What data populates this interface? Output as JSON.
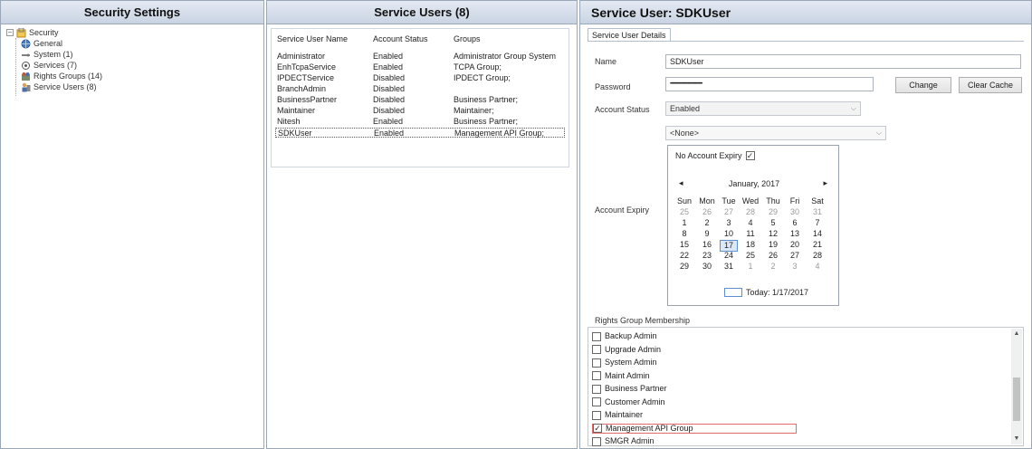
{
  "left_pane": {
    "title": "Security Settings",
    "tree": [
      {
        "label": "Security",
        "icon": "security-folder-icon"
      },
      {
        "label": "General",
        "icon": "globe-icon"
      },
      {
        "label": "System (1)",
        "icon": "system-icon"
      },
      {
        "label": "Services (7)",
        "icon": "services-icon"
      },
      {
        "label": "Rights Groups (14)",
        "icon": "rights-groups-icon"
      },
      {
        "label": "Service Users (8)",
        "icon": "service-users-icon"
      }
    ],
    "expander": "−"
  },
  "mid_pane": {
    "title": "Service Users (8)",
    "columns": [
      "Service User Name",
      "Account Status",
      "Groups"
    ],
    "rows": [
      {
        "name": "Administrator",
        "status": "Enabled",
        "groups": "Administrator Group System"
      },
      {
        "name": "EnhTcpaService",
        "status": "Enabled",
        "groups": "TCPA Group;"
      },
      {
        "name": "IPDECTService",
        "status": "Disabled",
        "groups": "IPDECT Group;"
      },
      {
        "name": "BranchAdmin",
        "status": "Disabled",
        "groups": ""
      },
      {
        "name": "BusinessPartner",
        "status": "Disabled",
        "groups": "Business Partner;"
      },
      {
        "name": "Maintainer",
        "status": "Disabled",
        "groups": "Maintainer;"
      },
      {
        "name": "Nitesh",
        "status": "Enabled",
        "groups": "Business Partner;"
      },
      {
        "name": "SDKUser",
        "status": "Enabled",
        "groups": "Management API Group;"
      }
    ]
  },
  "right_pane": {
    "title": "Service User:  SDKUser",
    "tab_label": "Service User Details",
    "name_label": "Name",
    "name_value": "SDKUser",
    "password_label": "Password",
    "password_value": "••••••••••••••••••••••••••••••••",
    "change_button": "Change",
    "clear_cache_button": "Clear Cache",
    "status_label": "Account Status",
    "status_value": "Enabled",
    "expiry_label": "Account Expiry",
    "expiry_value": "<None>",
    "no_expiry_label": "No Account Expiry",
    "no_expiry_check": "✓",
    "calendar": {
      "month_label": "January, 2017",
      "prev": "◂",
      "next": "▸",
      "day_names": [
        "Sun",
        "Mon",
        "Tue",
        "Wed",
        "Thu",
        "Fri",
        "Sat"
      ],
      "weeks": [
        [
          "25",
          "26",
          "27",
          "28",
          "29",
          "30",
          "31"
        ],
        [
          "1",
          "2",
          "3",
          "4",
          "5",
          "6",
          "7"
        ],
        [
          "8",
          "9",
          "10",
          "11",
          "12",
          "13",
          "14"
        ],
        [
          "15",
          "16",
          "17",
          "18",
          "19",
          "20",
          "21"
        ],
        [
          "22",
          "23",
          "24",
          "25",
          "26",
          "27",
          "28"
        ],
        [
          "29",
          "30",
          "31",
          "1",
          "2",
          "3",
          "4"
        ]
      ],
      "selected_day": "17",
      "today_label": "Today: 1/17/2017"
    },
    "rights_label": "Rights Group Membership",
    "rights_groups": [
      {
        "label": "Backup Admin",
        "checked": false
      },
      {
        "label": "Upgrade Admin",
        "checked": false
      },
      {
        "label": "System Admin",
        "checked": false
      },
      {
        "label": "Maint Admin",
        "checked": false
      },
      {
        "label": "Business Partner",
        "checked": false
      },
      {
        "label": "Customer Admin",
        "checked": false
      },
      {
        "label": "Maintainer",
        "checked": false
      },
      {
        "label": "Management API Group",
        "checked": true
      },
      {
        "label": "SMGR Admin",
        "checked": false
      }
    ],
    "check_mark": "✓",
    "scroll_up": "▲",
    "scroll_down": "▼"
  },
  "colors": {
    "header_gradient_top": "#e4eaf3",
    "header_gradient_bottom": "#c9d3e2",
    "highlight_border": "#e26a6a",
    "calendar_selected": "#5b8fd1"
  }
}
